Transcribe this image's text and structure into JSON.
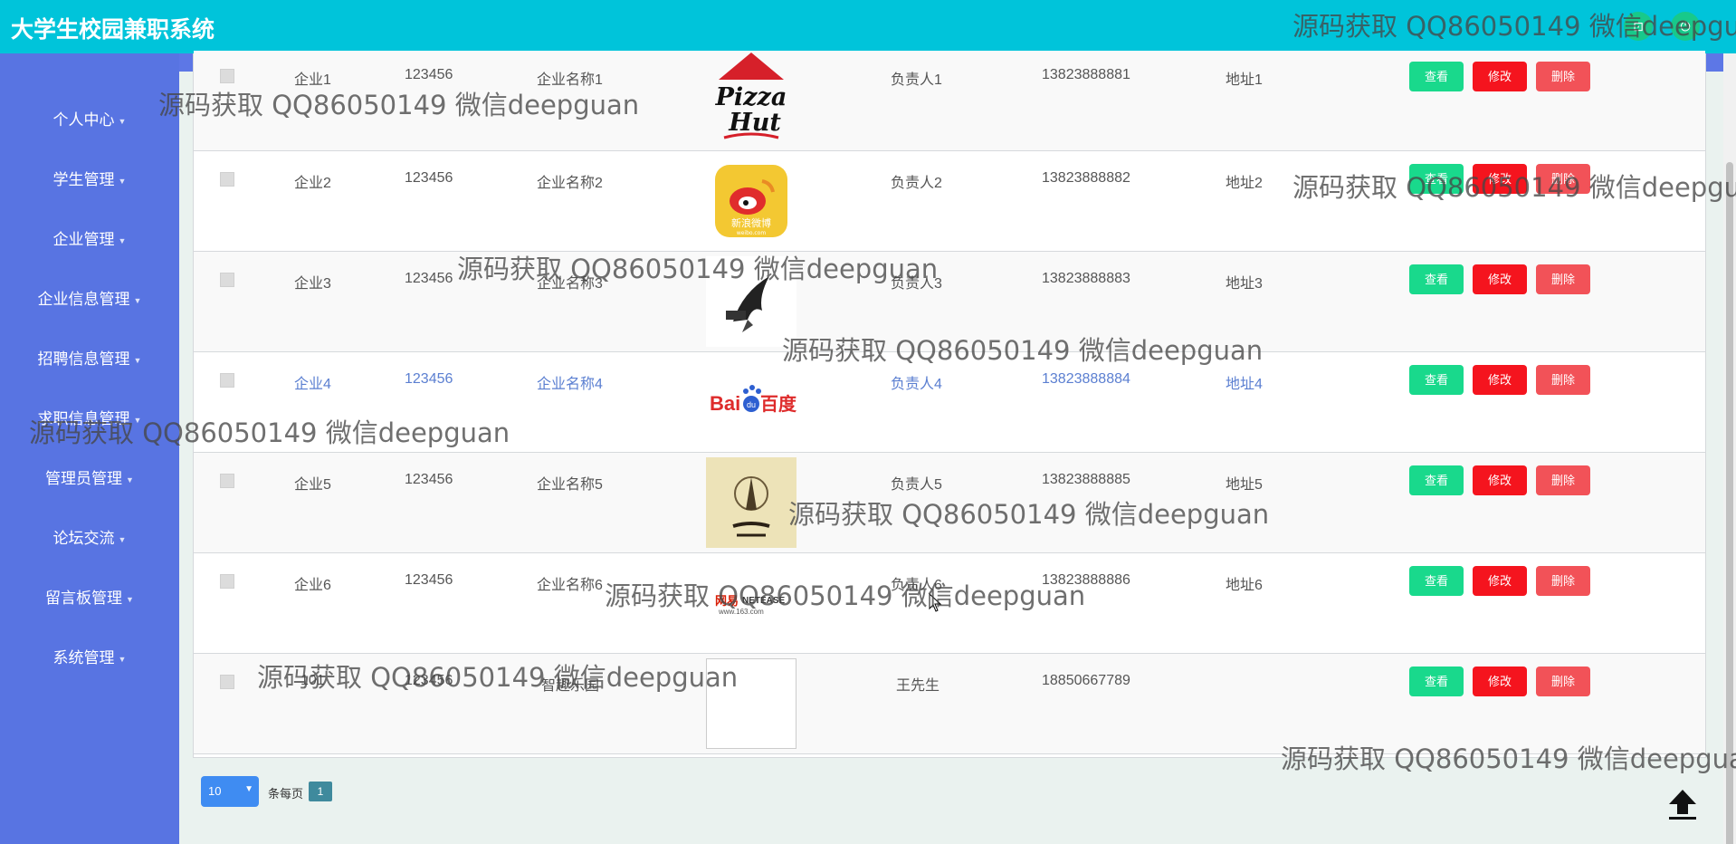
{
  "app": {
    "title": "大学生校园兼职系统"
  },
  "sidebar": {
    "items": [
      {
        "label": "个人中心"
      },
      {
        "label": "学生管理"
      },
      {
        "label": "企业管理"
      },
      {
        "label": "企业信息管理"
      },
      {
        "label": "招聘信息管理"
      },
      {
        "label": "求职信息管理"
      },
      {
        "label": "管理员管理"
      },
      {
        "label": "论坛交流"
      },
      {
        "label": "留言板管理"
      },
      {
        "label": "系统管理"
      }
    ]
  },
  "table": {
    "rows": [
      {
        "account": "企业1",
        "password": "123456",
        "name": "企业名称1",
        "logo": "Pizza Hut",
        "contact": "负责人1",
        "phone": "13823888881",
        "address": "地址1"
      },
      {
        "account": "企业2",
        "password": "123456",
        "name": "企业名称2",
        "logo": "新浪微博",
        "contact": "负责人2",
        "phone": "13823888882",
        "address": "地址2"
      },
      {
        "account": "企业3",
        "password": "123456",
        "name": "企业名称3",
        "logo": "bird-logo",
        "contact": "负责人3",
        "phone": "13823888883",
        "address": "地址3"
      },
      {
        "account": "企业4",
        "password": "123456",
        "name": "企业名称4",
        "logo": "Baidu百度",
        "contact": "负责人4",
        "phone": "13823888884",
        "address": "地址4"
      },
      {
        "account": "企业5",
        "password": "123456",
        "name": "企业名称5",
        "logo": "tower-logo",
        "contact": "负责人5",
        "phone": "13823888885",
        "address": "地址5"
      },
      {
        "account": "企业6",
        "password": "123456",
        "name": "企业名称6",
        "logo": "网易 NETEASE",
        "contact": "负责人6",
        "phone": "13823888886",
        "address": "地址6"
      },
      {
        "account": "101",
        "password": "123456",
        "name": "智趣乐园",
        "logo": "",
        "contact": "王先生",
        "phone": "18850667789",
        "address": ""
      }
    ],
    "actions": {
      "view": "查看",
      "edit": "修改",
      "delete": "删除"
    }
  },
  "logos": {
    "pizza_line1": "Pizza",
    "pizza_line2": "Hut",
    "weibo_text": "新浪微博",
    "weibo_sub": "weibo.com",
    "baidu_text": "Bai",
    "baidu_du": "du",
    "baidu_cn": "百度",
    "netease_cn": "网易",
    "netease_en": "NETEASE",
    "netease_sub": "www.163.com"
  },
  "pagination": {
    "page_size": "10",
    "per_page_label": "条每页",
    "current_page": "1"
  },
  "watermark": {
    "text": "源码获取 QQ86050149 微信deepguan"
  },
  "colors": {
    "header": "#00c4da",
    "sidebar": "#5874e2",
    "view": "#19d98c",
    "edit": "#f5141e",
    "delete": "#f25258"
  }
}
